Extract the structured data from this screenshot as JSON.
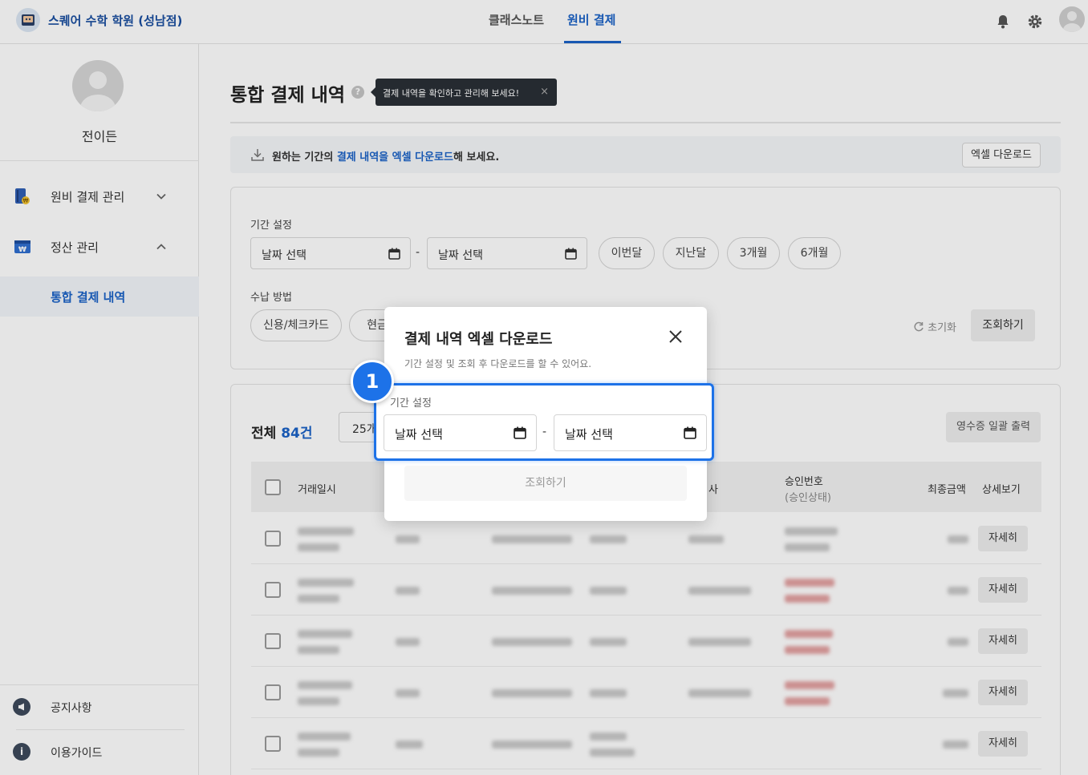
{
  "header": {
    "brand": "스퀘어 수학 학원 (성남점)",
    "tabs": [
      {
        "label": "클래스노트",
        "active": false
      },
      {
        "label": "원비 결제",
        "active": true
      }
    ],
    "icons": [
      "bell-icon",
      "gear-icon",
      "user-avatar-icon"
    ]
  },
  "sidebar": {
    "profile_name": "전이든",
    "items": [
      {
        "label": "원비 결제 관리",
        "icon": "payment-book-icon",
        "expanded": false
      },
      {
        "label": "정산 관리",
        "icon": "settlement-won-icon",
        "expanded": true
      }
    ],
    "sub_items": [
      {
        "label": "통합 결제 내역",
        "active": true
      }
    ],
    "bottom": [
      {
        "label": "공지사항",
        "icon": "megaphone-icon"
      },
      {
        "label": "이용가이드",
        "icon": "info-icon",
        "glyph": "i"
      }
    ]
  },
  "page": {
    "title": "통합 결제 내역",
    "help_glyph": "?",
    "tooltip": "결제 내역을 확인하고 관리해 보세요!",
    "tooltip_close": "×",
    "banner": {
      "prefix": "원하는 기간의 ",
      "highlight": "결제 내역을 엑셀 다운로드",
      "suffix": "해 보세요.",
      "button": "엑셀 다운로드"
    }
  },
  "filter": {
    "period_label": "기간 설정",
    "start_date": "날짜 선택",
    "end_date": "날짜 선택",
    "dash": "-",
    "quick_ranges": [
      "이번달",
      "지난달",
      "3개월",
      "6개월"
    ],
    "method_label": "수납 방법",
    "methods": [
      "신용/체크카드",
      "현금"
    ],
    "reset": "초기화",
    "search": "조회하기"
  },
  "list": {
    "total_prefix": "전체 ",
    "total_count": "84건",
    "page_size": "25개",
    "receipt_button": "영수증 일괄 출력",
    "columns": {
      "date": "거래일시",
      "company": "사",
      "approval": "승인번호",
      "approval_status": "(승인상태)",
      "amount": "최종금액",
      "detail": "상세보기"
    },
    "rows": [
      {
        "detail": "자세히",
        "status_color": "gray"
      },
      {
        "detail": "자세히",
        "status_color": "red"
      },
      {
        "detail": "자세히",
        "status_color": "red"
      },
      {
        "detail": "자세히",
        "status_color": "red"
      },
      {
        "detail": "자세히",
        "status_color": "none"
      }
    ]
  },
  "modal": {
    "title": "결제 내역 엑셀 다운로드",
    "subtitle": "기간 설정 및 조회 후 다운로드를 할 수 있어요.",
    "period_label": "기간 설정",
    "start_date": "날짜 선택",
    "end_date": "날짜 선택",
    "dash": "-",
    "submit": "조회하기",
    "close_icon": "close-icon"
  },
  "annotation": {
    "step": "1",
    "color": "#1d72e8"
  },
  "colors": {
    "primary": "#1b63c7",
    "highlight": "#1d72e8"
  }
}
